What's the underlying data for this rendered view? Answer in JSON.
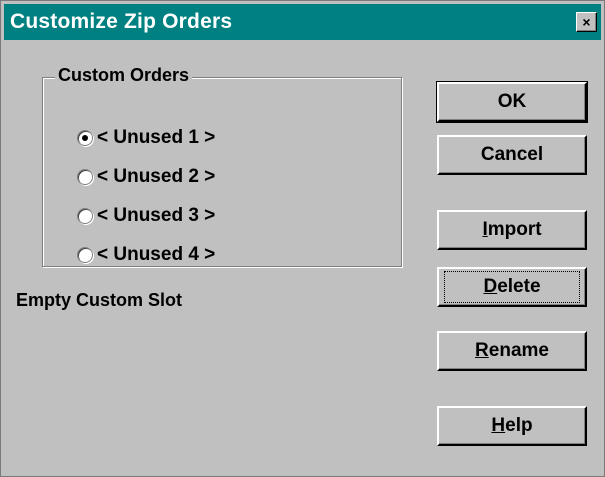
{
  "window": {
    "title": "Customize Zip Orders",
    "close_label": "×"
  },
  "group": {
    "legend": "Custom Orders",
    "options": [
      {
        "label": "< Unused 1 >",
        "selected": true
      },
      {
        "label": "< Unused 2 >",
        "selected": false
      },
      {
        "label": "< Unused 3 >",
        "selected": false
      },
      {
        "label": "< Unused 4 >",
        "selected": false
      }
    ]
  },
  "status": "Empty Custom Slot",
  "buttons": {
    "ok": "OK",
    "cancel": "Cancel",
    "import_key": "I",
    "import_rest": "mport",
    "delete_key": "D",
    "delete_rest": "elete",
    "rename_key": "R",
    "rename_rest": "ename",
    "help_key": "H",
    "help_rest": "elp"
  },
  "colors": {
    "titlebar": "#008080",
    "face": "#c0c0c0"
  }
}
